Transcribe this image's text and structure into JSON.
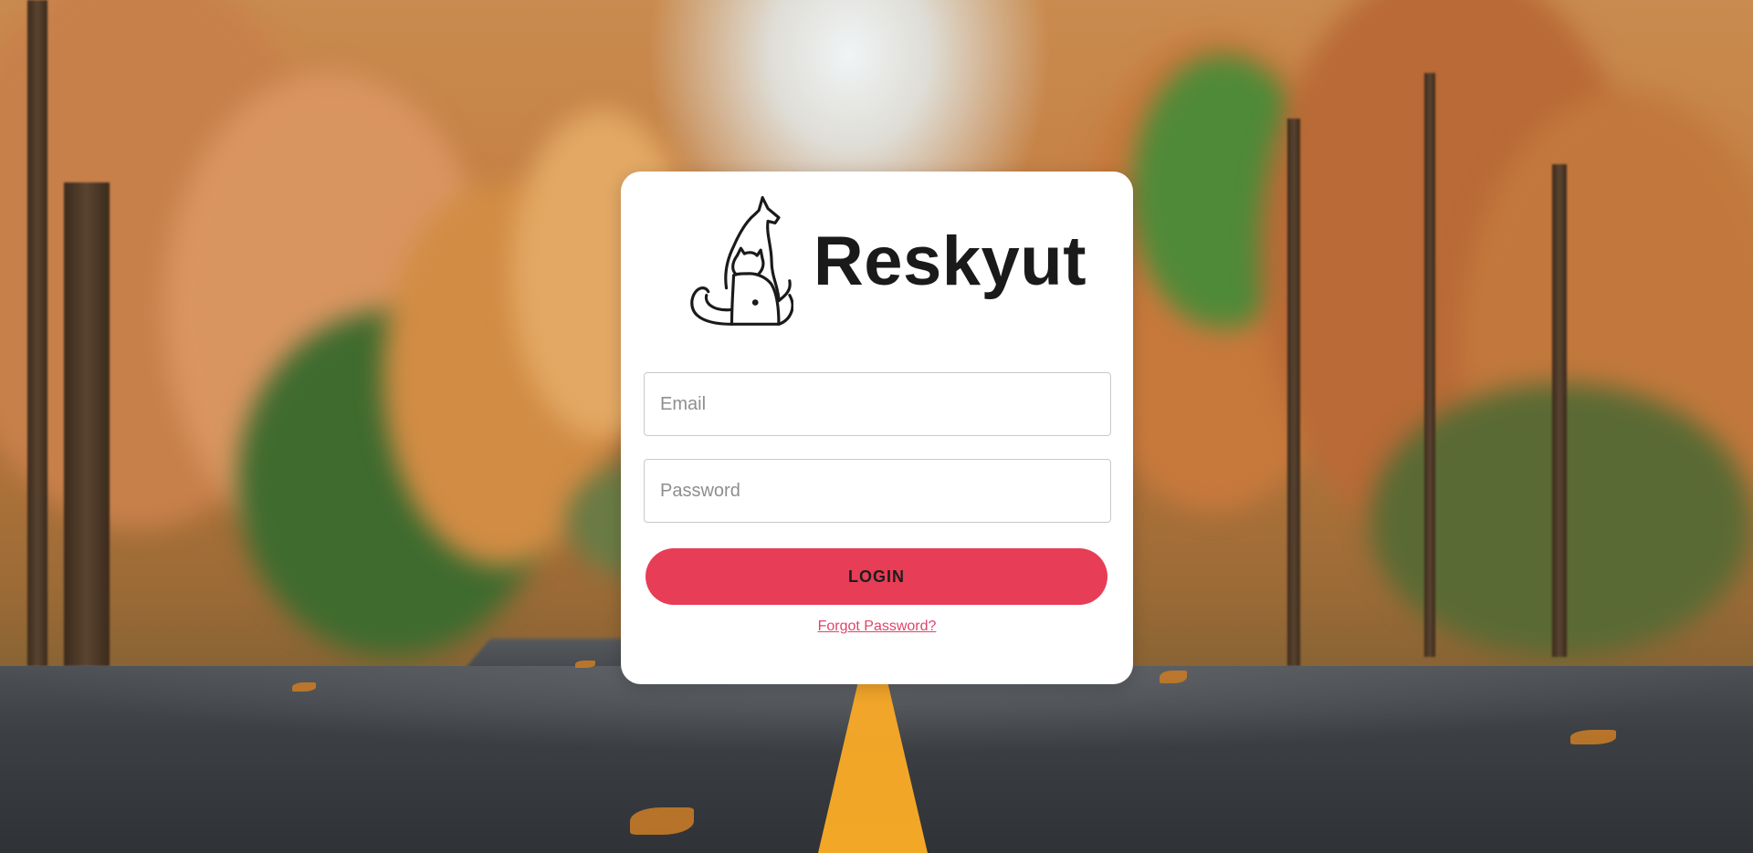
{
  "brand": {
    "name": "Reskyut",
    "logo_icon": "cat-dog-icon"
  },
  "form": {
    "email_placeholder": "Email",
    "password_placeholder": "Password",
    "login_label": "LOGIN",
    "forgot_label": "Forgot Password?"
  },
  "colors": {
    "accent": "#e73d56",
    "link": "#e0446a",
    "card": "#ffffff",
    "text": "#1a1a1a"
  },
  "background": {
    "scene": "autumn-forest-road"
  }
}
